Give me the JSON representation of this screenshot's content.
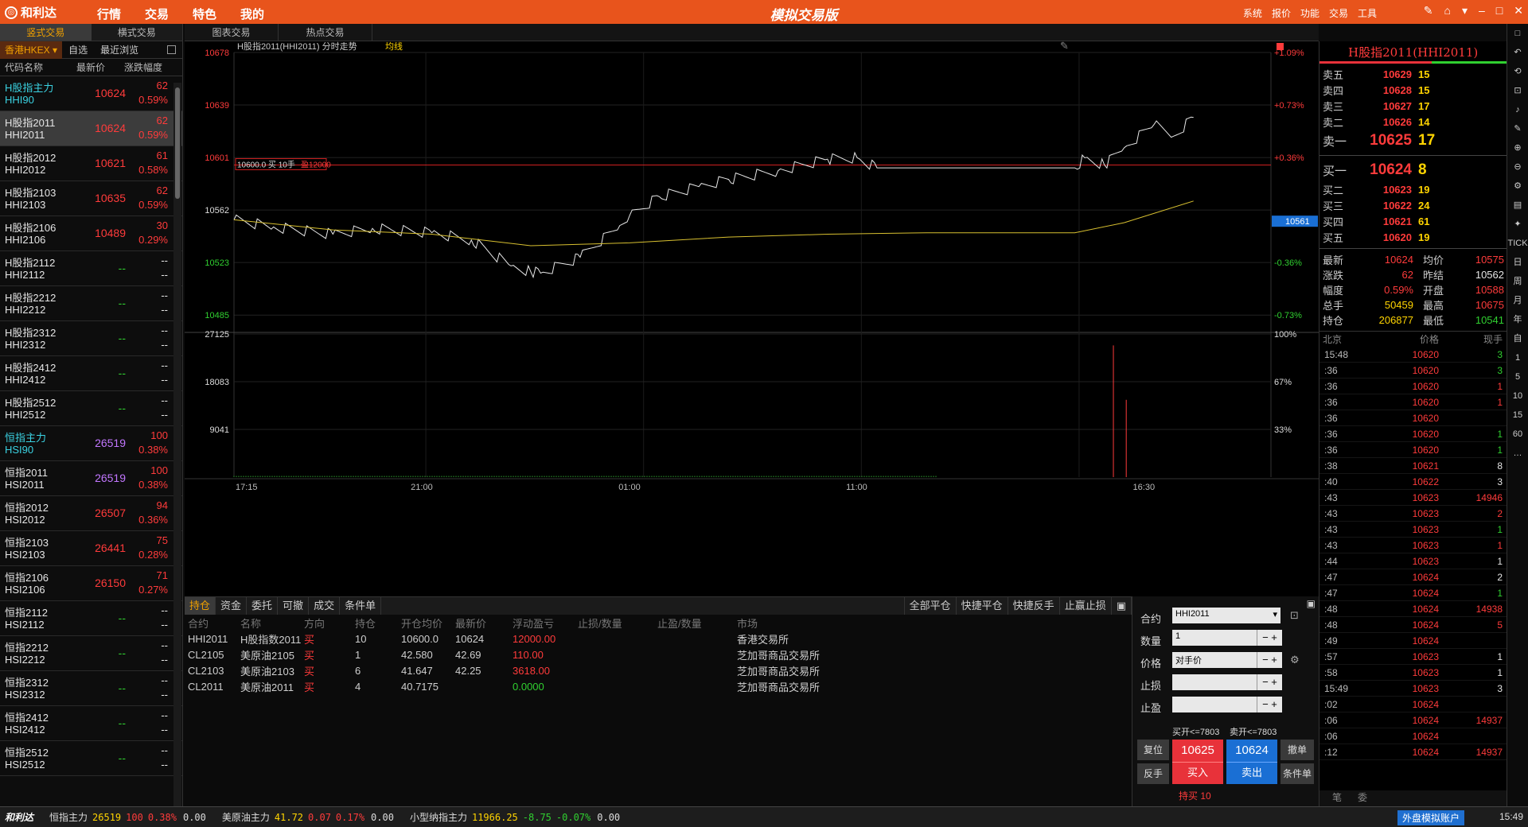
{
  "titlebar": {
    "logo": "和利达",
    "menu": [
      "行情",
      "交易",
      "特色",
      "我的"
    ],
    "center": "模拟交易版",
    "right": [
      "系统",
      "报价",
      "功能",
      "交易",
      "工具"
    ]
  },
  "left": {
    "tabs": [
      "竖式交易",
      "横式交易"
    ],
    "market": "香港HKEX",
    "subtabs": [
      "自选",
      "最近浏览"
    ],
    "headers": [
      "代码名称",
      "最新价",
      "涨跌幅度"
    ],
    "rows": [
      {
        "name": "H股指主力",
        "code": "HHI90",
        "price": "10624",
        "chg": "62",
        "pct": "0.59%",
        "cls": "cyan"
      },
      {
        "name": "H股指2011",
        "code": "HHI2011",
        "price": "10624",
        "chg": "62",
        "pct": "0.59%",
        "cls": "white",
        "sel": true
      },
      {
        "name": "H股指2012",
        "code": "HHI2012",
        "price": "10621",
        "chg": "61",
        "pct": "0.58%",
        "cls": "white"
      },
      {
        "name": "H股指2103",
        "code": "HHI2103",
        "price": "10635",
        "chg": "62",
        "pct": "0.59%",
        "cls": "white"
      },
      {
        "name": "H股指2106",
        "code": "HHI2106",
        "price": "10489",
        "chg": "30",
        "pct": "0.29%",
        "cls": "white"
      },
      {
        "name": "H股指2112",
        "code": "HHI2112",
        "price": "--",
        "chg": "--",
        "pct": "--",
        "cls": "white"
      },
      {
        "name": "H股指2212",
        "code": "HHI2212",
        "price": "--",
        "chg": "--",
        "pct": "--",
        "cls": "white"
      },
      {
        "name": "H股指2312",
        "code": "HHI2312",
        "price": "--",
        "chg": "--",
        "pct": "--",
        "cls": "white"
      },
      {
        "name": "H股指2412",
        "code": "HHI2412",
        "price": "--",
        "chg": "--",
        "pct": "--",
        "cls": "white"
      },
      {
        "name": "H股指2512",
        "code": "HHI2512",
        "price": "--",
        "chg": "--",
        "pct": "--",
        "cls": "white"
      },
      {
        "name": "恒指主力",
        "code": "HSI90",
        "price": "26519",
        "chg": "100",
        "pct": "0.38%",
        "cls": "cyan"
      },
      {
        "name": "恒指2011",
        "code": "HSI2011",
        "price": "26519",
        "chg": "100",
        "pct": "0.38%",
        "cls": "white"
      },
      {
        "name": "恒指2012",
        "code": "HSI2012",
        "price": "26507",
        "chg": "94",
        "pct": "0.36%",
        "cls": "white"
      },
      {
        "name": "恒指2103",
        "code": "HSI2103",
        "price": "26441",
        "chg": "75",
        "pct": "0.28%",
        "cls": "white"
      },
      {
        "name": "恒指2106",
        "code": "HSI2106",
        "price": "26150",
        "chg": "71",
        "pct": "0.27%",
        "cls": "white"
      },
      {
        "name": "恒指2112",
        "code": "HSI2112",
        "price": "--",
        "chg": "--",
        "pct": "--",
        "cls": "white"
      },
      {
        "name": "恒指2212",
        "code": "HSI2212",
        "price": "--",
        "chg": "--",
        "pct": "--",
        "cls": "white"
      },
      {
        "name": "恒指2312",
        "code": "HSI2312",
        "price": "--",
        "chg": "--",
        "pct": "--",
        "cls": "white"
      },
      {
        "name": "恒指2412",
        "code": "HSI2412",
        "price": "--",
        "chg": "--",
        "pct": "--",
        "cls": "white"
      },
      {
        "name": "恒指2512",
        "code": "HSI2512",
        "price": "--",
        "chg": "--",
        "pct": "--",
        "cls": "white"
      }
    ]
  },
  "toptabs": [
    "图表交易",
    "热点交易"
  ],
  "chart": {
    "title": "H股指2011(HHI2011) 分时走势",
    "avg_label": "均线",
    "order_label": "10600.0 买 10手",
    "order_pnl": "盈12000",
    "last_tag": "10561",
    "left_ticks": [
      "10678",
      "10639",
      "10601",
      "10562",
      "10523",
      "10485"
    ],
    "right_ticks": [
      "+1.09%",
      "+0.73%",
      "+0.36%",
      "",
      "-0.36%",
      "-0.73%"
    ],
    "vol_left": [
      "27125",
      "18083",
      "9041"
    ],
    "vol_right": [
      "100%",
      "67%",
      "33%"
    ],
    "time_ticks": [
      "17:15",
      "21:00",
      "01:00",
      "11:00",
      "16:30"
    ]
  },
  "chart_data": {
    "type": "line",
    "title": "H股指2011(HHI2011) 分时走势",
    "xlabel": "",
    "ylabel": "",
    "ylim": [
      10485,
      10678
    ],
    "x_ticks": [
      "17:15",
      "21:00",
      "01:00",
      "11:00",
      "16:30"
    ],
    "series": [
      {
        "name": "",
        "x_frac": [
          0,
          0.04,
          0.1,
          0.14,
          0.2,
          0.24,
          0.28,
          0.3,
          0.31,
          0.35,
          0.39,
          0.4,
          0.43,
          0.47,
          0.5,
          0.55,
          0.6,
          0.63,
          0.65,
          0.66,
          0.68,
          0.71,
          0.75,
          0.85,
          0.86,
          0.88,
          0.9,
          0.93,
          0.95,
          0.97
        ],
        "values": [
          10562,
          10557,
          10552,
          10556,
          10553,
          10548,
          10530,
          10526,
          10525,
          10536,
          10558,
          10565,
          10578,
          10585,
          10590,
          10596,
          10604,
          10605,
          10598,
          10598,
          10598,
          10598,
          10598,
          10598,
          10605,
          10600,
          10612,
          10628,
          10620,
          10633
        ]
      },
      {
        "name": "均线",
        "x_frac": [
          0,
          0.1,
          0.2,
          0.3,
          0.4,
          0.5,
          0.6,
          0.7,
          0.85,
          0.9,
          0.97
        ],
        "values": [
          10562,
          10555,
          10552,
          10544,
          10546,
          10550,
          10552,
          10553,
          10553,
          10560,
          10575
        ]
      }
    ]
  },
  "bottom": {
    "tabs": [
      "持仓",
      "资金",
      "委托",
      "可撤",
      "成交",
      "条件单"
    ],
    "actions": [
      "全部平仓",
      "快捷平仓",
      "快捷反手",
      "止赢止损"
    ],
    "headers": [
      "合约",
      "名称",
      "方向",
      "持仓",
      "开仓均价",
      "最新价",
      "浮动盈亏",
      "止损/数量",
      "止盈/数量",
      "市场"
    ],
    "rows": [
      {
        "c": "HHI2011",
        "n": "H股指数2011",
        "d": "买",
        "q": "10",
        "o": "10600.0",
        "l": "10624",
        "p": "12000.00",
        "pc": "red",
        "s": "",
        "t": "",
        "m": "香港交易所"
      },
      {
        "c": "CL2105",
        "n": "美原油2105",
        "d": "买",
        "q": "1",
        "o": "42.580",
        "l": "42.69",
        "p": "110.00",
        "pc": "red",
        "s": "",
        "t": "",
        "m": "芝加哥商品交易所"
      },
      {
        "c": "CL2103",
        "n": "美原油2103",
        "d": "买",
        "q": "6",
        "o": "41.647",
        "l": "42.25",
        "p": "3618.00",
        "pc": "red",
        "s": "",
        "t": "",
        "m": "芝加哥商品交易所"
      },
      {
        "c": "CL2011",
        "n": "美原油2011",
        "d": "买",
        "q": "4",
        "o": "40.7175",
        "l": "",
        "p": "0.0000",
        "pc": "green",
        "s": "",
        "t": "",
        "m": "芝加哥商品交易所"
      }
    ]
  },
  "order": {
    "contract_label": "合约",
    "contract": "HHI2011",
    "qty_label": "数量",
    "qty": "1",
    "price_label": "价格",
    "price": "对手价",
    "sl_label": "止损",
    "tp_label": "止盈",
    "open_buy": "买开<=7803",
    "open_sell": "卖开<=7803",
    "reset": "复位",
    "reverse": "反手",
    "buy_price": "10625",
    "buy": "买入",
    "sell_price": "10624",
    "sell": "卖出",
    "cancel": "撤单",
    "cond": "条件单",
    "hold": "持买 10"
  },
  "right": {
    "title": "H股指2011(HHI2011)",
    "asks": [
      {
        "l": "卖五",
        "p": "10629",
        "v": "15"
      },
      {
        "l": "卖四",
        "p": "10628",
        "v": "15"
      },
      {
        "l": "卖三",
        "p": "10627",
        "v": "17"
      },
      {
        "l": "卖二",
        "p": "10626",
        "v": "14"
      },
      {
        "l": "卖一",
        "p": "10625",
        "v": "17"
      }
    ],
    "bids": [
      {
        "l": "买一",
        "p": "10624",
        "v": "8"
      },
      {
        "l": "买二",
        "p": "10623",
        "v": "19"
      },
      {
        "l": "买三",
        "p": "10622",
        "v": "24"
      },
      {
        "l": "买四",
        "p": "10621",
        "v": "61"
      },
      {
        "l": "买五",
        "p": "10620",
        "v": "19"
      }
    ],
    "stats": [
      {
        "a": "最新",
        "b": "10624",
        "bc": "red",
        "c": "均价",
        "d": "10575",
        "dc": "red"
      },
      {
        "a": "涨跌",
        "b": "62",
        "bc": "red",
        "c": "昨结",
        "d": "10562",
        "dc": "white"
      },
      {
        "a": "幅度",
        "b": "0.59%",
        "bc": "red",
        "c": "开盘",
        "d": "10588",
        "dc": "red"
      },
      {
        "a": "总手",
        "b": "50459",
        "bc": "yellow",
        "c": "最高",
        "d": "10675",
        "dc": "red"
      },
      {
        "a": "持仓",
        "b": "206877",
        "bc": "yellow",
        "c": "最低",
        "d": "10541",
        "dc": "green"
      }
    ],
    "tick_headers": [
      "北京",
      "价格",
      "现手"
    ],
    "ticks": [
      {
        "t": "15:48",
        "p": "10620",
        "v": "3",
        "vc": "green"
      },
      {
        "t": ":36",
        "p": "10620",
        "v": "3",
        "vc": "green"
      },
      {
        "t": ":36",
        "p": "10620",
        "v": "1",
        "vc": "red"
      },
      {
        "t": ":36",
        "p": "10620",
        "v": "1",
        "vc": "red"
      },
      {
        "t": ":36",
        "p": "10620",
        "v": "",
        "vc": "red"
      },
      {
        "t": ":36",
        "p": "10620",
        "v": "1",
        "vc": "green"
      },
      {
        "t": ":36",
        "p": "10620",
        "v": "1",
        "vc": "green"
      },
      {
        "t": ":38",
        "p": "10621",
        "v": "8",
        "vc": "white"
      },
      {
        "t": ":40",
        "p": "10622",
        "v": "3",
        "vc": "white"
      },
      {
        "t": ":43",
        "p": "10623",
        "v": "14946",
        "vc": "red"
      },
      {
        "t": ":43",
        "p": "10623",
        "v": "2",
        "vc": "red"
      },
      {
        "t": ":43",
        "p": "10623",
        "v": "1",
        "vc": "green"
      },
      {
        "t": ":43",
        "p": "10623",
        "v": "1",
        "vc": "red"
      },
      {
        "t": ":44",
        "p": "10623",
        "v": "1",
        "vc": "white"
      },
      {
        "t": ":47",
        "p": "10624",
        "v": "2",
        "vc": "white"
      },
      {
        "t": ":47",
        "p": "10624",
        "v": "1",
        "vc": "green"
      },
      {
        "t": ":48",
        "p": "10624",
        "v": "14938",
        "vc": "red"
      },
      {
        "t": ":48",
        "p": "10624",
        "v": "5",
        "vc": "red"
      },
      {
        "t": ":49",
        "p": "10624",
        "v": "",
        "vc": "white"
      },
      {
        "t": ":57",
        "p": "10623",
        "v": "1",
        "vc": "white"
      },
      {
        "t": ":58",
        "p": "10623",
        "v": "1",
        "vc": "white"
      },
      {
        "t": "15:49",
        "p": "10623",
        "v": "3",
        "vc": "white"
      },
      {
        "t": ":02",
        "p": "10624",
        "v": "",
        "vc": "white"
      },
      {
        "t": ":06",
        "p": "10624",
        "v": "14937",
        "vc": "red"
      },
      {
        "t": ":06",
        "p": "10624",
        "v": "",
        "vc": "white"
      },
      {
        "t": ":12",
        "p": "10624",
        "v": "14937",
        "vc": "red"
      }
    ],
    "bottom_tabs": [
      "笔",
      "委"
    ]
  },
  "sidetools": [
    "□",
    "↶",
    "⟲",
    "⊡",
    "♪",
    "✎",
    "⊕",
    "⊖",
    "⚙",
    "▤",
    "✦",
    "TICK",
    "日",
    "周",
    "月",
    "年",
    "自",
    "1",
    "5",
    "10",
    "15",
    "60",
    "…"
  ],
  "status": {
    "logo": "和利达",
    "items": [
      {
        "n": "恒指主力",
        "p": "26519",
        "c": "100",
        "pc": "0.38%",
        "x": "0.00",
        "col": "red"
      },
      {
        "n": "美原油主力",
        "p": "41.72",
        "c": "0.07",
        "pc": "0.17%",
        "x": "0.00",
        "col": "red"
      },
      {
        "n": "小型纳指主力",
        "p": "11966.25",
        "c": "-8.75",
        "pc": "-0.07%",
        "x": "0.00",
        "col": "green"
      }
    ],
    "account": "外盘模拟账户",
    "time": "15:49"
  },
  "colors": {
    "accent": "#e8541c",
    "up": "#ff3b3b",
    "down": "#30d030",
    "avg": "#ffd400"
  }
}
